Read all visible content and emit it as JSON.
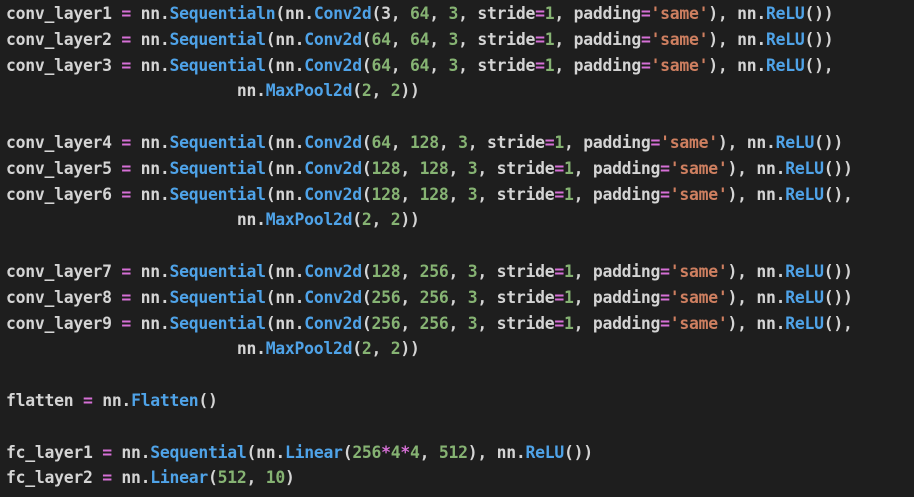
{
  "editor": {
    "colors": {
      "background": "#1e1e1e",
      "plain": "#d4d4d4",
      "operator": "#d670d6",
      "function": "#4fa3e8",
      "number": "#86b373",
      "string": "#ce7f60"
    },
    "lines": [
      [
        [
          "plain",
          "conv_layer1 "
        ],
        [
          "op",
          "="
        ],
        [
          "plain",
          " nn."
        ],
        [
          "func",
          "Sequentialn"
        ],
        [
          "plain",
          "(nn."
        ],
        [
          "func",
          "Conv2d"
        ],
        [
          "plain",
          "(3, "
        ],
        [
          "num",
          "64"
        ],
        [
          "plain",
          ", "
        ],
        [
          "num",
          "3"
        ],
        [
          "plain",
          ", stride"
        ],
        [
          "op",
          "="
        ],
        [
          "num",
          "1"
        ],
        [
          "plain",
          ", padding"
        ],
        [
          "op",
          "="
        ],
        [
          "str",
          "'same'"
        ],
        [
          "plain",
          "), nn."
        ],
        [
          "func",
          "ReLU"
        ],
        [
          "plain",
          "())"
        ]
      ],
      [
        [
          "plain",
          "conv_layer2 "
        ],
        [
          "op",
          "="
        ],
        [
          "plain",
          " nn."
        ],
        [
          "func",
          "Sequential"
        ],
        [
          "plain",
          "(nn."
        ],
        [
          "func",
          "Conv2d"
        ],
        [
          "plain",
          "("
        ],
        [
          "num",
          "64"
        ],
        [
          "plain",
          ", "
        ],
        [
          "num",
          "64"
        ],
        [
          "plain",
          ", "
        ],
        [
          "num",
          "3"
        ],
        [
          "plain",
          ", stride"
        ],
        [
          "op",
          "="
        ],
        [
          "num",
          "1"
        ],
        [
          "plain",
          ", padding"
        ],
        [
          "op",
          "="
        ],
        [
          "str",
          "'same'"
        ],
        [
          "plain",
          "), nn."
        ],
        [
          "func",
          "ReLU"
        ],
        [
          "plain",
          "())"
        ]
      ],
      [
        [
          "plain",
          "conv_layer3 "
        ],
        [
          "op",
          "="
        ],
        [
          "plain",
          " nn."
        ],
        [
          "func",
          "Sequential"
        ],
        [
          "plain",
          "(nn."
        ],
        [
          "func",
          "Conv2d"
        ],
        [
          "plain",
          "("
        ],
        [
          "num",
          "64"
        ],
        [
          "plain",
          ", "
        ],
        [
          "num",
          "64"
        ],
        [
          "plain",
          ", "
        ],
        [
          "num",
          "3"
        ],
        [
          "plain",
          ", stride"
        ],
        [
          "op",
          "="
        ],
        [
          "num",
          "1"
        ],
        [
          "plain",
          ", padding"
        ],
        [
          "op",
          "="
        ],
        [
          "str",
          "'same'"
        ],
        [
          "plain",
          "), nn."
        ],
        [
          "func",
          "ReLU"
        ],
        [
          "plain",
          "(),"
        ]
      ],
      [
        [
          "plain",
          "                        nn."
        ],
        [
          "func",
          "MaxPool2d"
        ],
        [
          "plain",
          "("
        ],
        [
          "num",
          "2"
        ],
        [
          "plain",
          ", "
        ],
        [
          "num",
          "2"
        ],
        [
          "plain",
          "))"
        ]
      ],
      [],
      [
        [
          "plain",
          "conv_layer4 "
        ],
        [
          "op",
          "="
        ],
        [
          "plain",
          " nn."
        ],
        [
          "func",
          "Sequential"
        ],
        [
          "plain",
          "(nn."
        ],
        [
          "func",
          "Conv2d"
        ],
        [
          "plain",
          "("
        ],
        [
          "num",
          "64"
        ],
        [
          "plain",
          ", "
        ],
        [
          "num",
          "128"
        ],
        [
          "plain",
          ", "
        ],
        [
          "num",
          "3"
        ],
        [
          "plain",
          ", stride"
        ],
        [
          "op",
          "="
        ],
        [
          "num",
          "1"
        ],
        [
          "plain",
          ", padding"
        ],
        [
          "op",
          "="
        ],
        [
          "str",
          "'same'"
        ],
        [
          "plain",
          "), nn."
        ],
        [
          "func",
          "ReLU"
        ],
        [
          "plain",
          "())"
        ]
      ],
      [
        [
          "plain",
          "conv_layer5 "
        ],
        [
          "op",
          "="
        ],
        [
          "plain",
          " nn."
        ],
        [
          "func",
          "Sequential"
        ],
        [
          "plain",
          "(nn."
        ],
        [
          "func",
          "Conv2d"
        ],
        [
          "plain",
          "("
        ],
        [
          "num",
          "128"
        ],
        [
          "plain",
          ", "
        ],
        [
          "num",
          "128"
        ],
        [
          "plain",
          ", "
        ],
        [
          "num",
          "3"
        ],
        [
          "plain",
          ", stride"
        ],
        [
          "op",
          "="
        ],
        [
          "num",
          "1"
        ],
        [
          "plain",
          ", padding"
        ],
        [
          "op",
          "="
        ],
        [
          "str",
          "'same'"
        ],
        [
          "plain",
          "), nn."
        ],
        [
          "func",
          "ReLU"
        ],
        [
          "plain",
          "())"
        ]
      ],
      [
        [
          "plain",
          "conv_layer6 "
        ],
        [
          "op",
          "="
        ],
        [
          "plain",
          " nn."
        ],
        [
          "func",
          "Sequential"
        ],
        [
          "plain",
          "(nn."
        ],
        [
          "func",
          "Conv2d"
        ],
        [
          "plain",
          "("
        ],
        [
          "num",
          "128"
        ],
        [
          "plain",
          ", "
        ],
        [
          "num",
          "128"
        ],
        [
          "plain",
          ", "
        ],
        [
          "num",
          "3"
        ],
        [
          "plain",
          ", stride"
        ],
        [
          "op",
          "="
        ],
        [
          "num",
          "1"
        ],
        [
          "plain",
          ", padding"
        ],
        [
          "op",
          "="
        ],
        [
          "str",
          "'same'"
        ],
        [
          "plain",
          "), nn."
        ],
        [
          "func",
          "ReLU"
        ],
        [
          "plain",
          "(),"
        ]
      ],
      [
        [
          "plain",
          "                        nn."
        ],
        [
          "func",
          "MaxPool2d"
        ],
        [
          "plain",
          "("
        ],
        [
          "num",
          "2"
        ],
        [
          "plain",
          ", "
        ],
        [
          "num",
          "2"
        ],
        [
          "plain",
          "))"
        ]
      ],
      [],
      [
        [
          "plain",
          "conv_layer7 "
        ],
        [
          "op",
          "="
        ],
        [
          "plain",
          " nn."
        ],
        [
          "func",
          "Sequential"
        ],
        [
          "plain",
          "(nn."
        ],
        [
          "func",
          "Conv2d"
        ],
        [
          "plain",
          "("
        ],
        [
          "num",
          "128"
        ],
        [
          "plain",
          ", "
        ],
        [
          "num",
          "256"
        ],
        [
          "plain",
          ", "
        ],
        [
          "num",
          "3"
        ],
        [
          "plain",
          ", stride"
        ],
        [
          "op",
          "="
        ],
        [
          "num",
          "1"
        ],
        [
          "plain",
          ", padding"
        ],
        [
          "op",
          "="
        ],
        [
          "str",
          "'same'"
        ],
        [
          "plain",
          "), nn."
        ],
        [
          "func",
          "ReLU"
        ],
        [
          "plain",
          "())"
        ]
      ],
      [
        [
          "plain",
          "conv_layer8 "
        ],
        [
          "op",
          "="
        ],
        [
          "plain",
          " nn."
        ],
        [
          "func",
          "Sequential"
        ],
        [
          "plain",
          "(nn."
        ],
        [
          "func",
          "Conv2d"
        ],
        [
          "plain",
          "("
        ],
        [
          "num",
          "256"
        ],
        [
          "plain",
          ", "
        ],
        [
          "num",
          "256"
        ],
        [
          "plain",
          ", "
        ],
        [
          "num",
          "3"
        ],
        [
          "plain",
          ", stride"
        ],
        [
          "op",
          "="
        ],
        [
          "num",
          "1"
        ],
        [
          "plain",
          ", padding"
        ],
        [
          "op",
          "="
        ],
        [
          "str",
          "'same'"
        ],
        [
          "plain",
          "), nn."
        ],
        [
          "func",
          "ReLU"
        ],
        [
          "plain",
          "())"
        ]
      ],
      [
        [
          "plain",
          "conv_layer9 "
        ],
        [
          "op",
          "="
        ],
        [
          "plain",
          " nn."
        ],
        [
          "func",
          "Sequential"
        ],
        [
          "plain",
          "(nn."
        ],
        [
          "func",
          "Conv2d"
        ],
        [
          "plain",
          "("
        ],
        [
          "num",
          "256"
        ],
        [
          "plain",
          ", "
        ],
        [
          "num",
          "256"
        ],
        [
          "plain",
          ", "
        ],
        [
          "num",
          "3"
        ],
        [
          "plain",
          ", stride"
        ],
        [
          "op",
          "="
        ],
        [
          "num",
          "1"
        ],
        [
          "plain",
          ", padding"
        ],
        [
          "op",
          "="
        ],
        [
          "str",
          "'same'"
        ],
        [
          "plain",
          "), nn."
        ],
        [
          "func",
          "ReLU"
        ],
        [
          "plain",
          "(),"
        ]
      ],
      [
        [
          "plain",
          "                        nn."
        ],
        [
          "func",
          "MaxPool2d"
        ],
        [
          "plain",
          "("
        ],
        [
          "num",
          "2"
        ],
        [
          "plain",
          ", "
        ],
        [
          "num",
          "2"
        ],
        [
          "plain",
          "))"
        ]
      ],
      [],
      [
        [
          "plain",
          "flatten "
        ],
        [
          "op",
          "="
        ],
        [
          "plain",
          " nn."
        ],
        [
          "func",
          "Flatten"
        ],
        [
          "plain",
          "()"
        ]
      ],
      [],
      [
        [
          "plain",
          "fc_layer1 "
        ],
        [
          "op",
          "="
        ],
        [
          "plain",
          " nn."
        ],
        [
          "func",
          "Sequential"
        ],
        [
          "plain",
          "(nn."
        ],
        [
          "func",
          "Linear"
        ],
        [
          "plain",
          "("
        ],
        [
          "num",
          "256"
        ],
        [
          "op",
          "*"
        ],
        [
          "num",
          "4"
        ],
        [
          "op",
          "*"
        ],
        [
          "num",
          "4"
        ],
        [
          "plain",
          ", "
        ],
        [
          "num",
          "512"
        ],
        [
          "plain",
          "), nn."
        ],
        [
          "func",
          "ReLU"
        ],
        [
          "plain",
          "())"
        ]
      ],
      [
        [
          "plain",
          "fc_layer2 "
        ],
        [
          "op",
          "="
        ],
        [
          "plain",
          " nn."
        ],
        [
          "func",
          "Linear"
        ],
        [
          "plain",
          "("
        ],
        [
          "num",
          "512"
        ],
        [
          "plain",
          ", "
        ],
        [
          "num",
          "10"
        ],
        [
          "plain",
          ")"
        ]
      ]
    ]
  }
}
